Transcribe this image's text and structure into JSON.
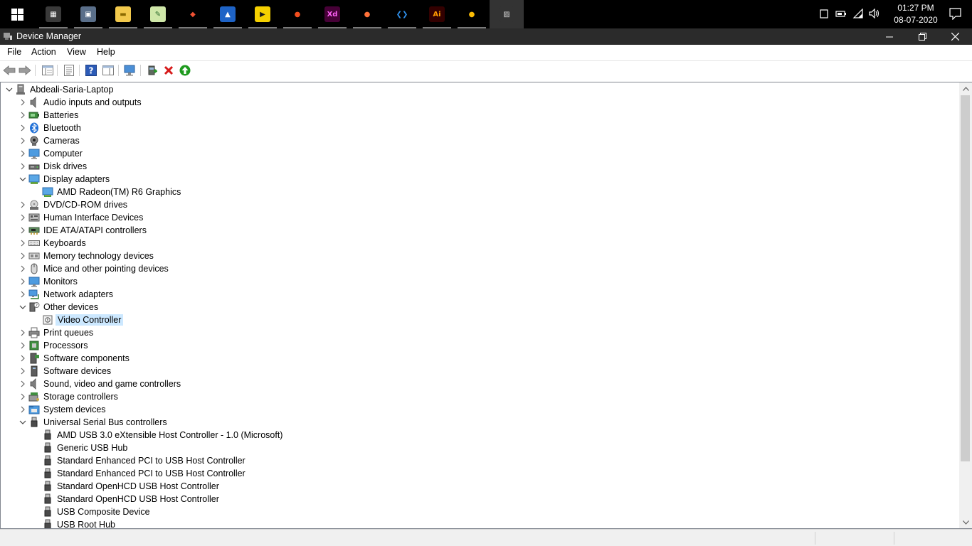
{
  "taskbar": {
    "apps": [
      {
        "name": "calculator",
        "glyph": "▦",
        "bg": "#3a3a3a",
        "fg": "#ffffff"
      },
      {
        "name": "photos",
        "glyph": "▣",
        "bg": "#5a6f8a",
        "fg": "#ffffff"
      },
      {
        "name": "file-explorer",
        "glyph": "▬",
        "bg": "#f2c94c",
        "fg": "#8a6a00"
      },
      {
        "name": "notepad",
        "glyph": "✎",
        "bg": "#cfe7a8",
        "fg": "#2e6b2e"
      },
      {
        "name": "git",
        "glyph": "◆",
        "bg": "#000000",
        "fg": "#f05133"
      },
      {
        "name": "photo-viewer",
        "glyph": "▲",
        "bg": "#1e63c6",
        "fg": "#ffffff"
      },
      {
        "name": "vlc-player",
        "glyph": "▶",
        "bg": "#f5d000",
        "fg": "#1a1a1a"
      },
      {
        "name": "figma",
        "glyph": "●",
        "bg": "#000000",
        "fg": "#f24e1e"
      },
      {
        "name": "adobe-xd",
        "glyph": "Xd",
        "bg": "#470137",
        "fg": "#ff61f6"
      },
      {
        "name": "firefox",
        "glyph": "●",
        "bg": "#000000",
        "fg": "#ff7139"
      },
      {
        "name": "vs-code",
        "glyph": "❮❯",
        "bg": "#000000",
        "fg": "#2f8fea"
      },
      {
        "name": "adobe-illustrator",
        "glyph": "Ai",
        "bg": "#330000",
        "fg": "#ff9a00"
      },
      {
        "name": "chrome",
        "glyph": "●",
        "bg": "#000000",
        "fg": "#fbbc05"
      },
      {
        "name": "device-manager",
        "glyph": "▨",
        "bg": "#333333",
        "fg": "#d0d0d0"
      }
    ],
    "time": "01:27 PM",
    "date": "08-07-2020"
  },
  "window": {
    "title": "Device Manager"
  },
  "menu": [
    "File",
    "Action",
    "View",
    "Help"
  ],
  "tree": {
    "root": "Abdeali-Saria-Laptop",
    "nodes": [
      {
        "label": "Audio inputs and outputs",
        "level": 1,
        "expanded": false,
        "icon": "speaker-icon"
      },
      {
        "label": "Batteries",
        "level": 1,
        "expanded": false,
        "icon": "battery-icon"
      },
      {
        "label": "Bluetooth",
        "level": 1,
        "expanded": false,
        "icon": "bluetooth-icon"
      },
      {
        "label": "Cameras",
        "level": 1,
        "expanded": false,
        "icon": "camera-icon"
      },
      {
        "label": "Computer",
        "level": 1,
        "expanded": false,
        "icon": "monitor-icon"
      },
      {
        "label": "Disk drives",
        "level": 1,
        "expanded": false,
        "icon": "disk-drive-icon"
      },
      {
        "label": "Display adapters",
        "level": 1,
        "expanded": true,
        "icon": "display-adapter-icon"
      },
      {
        "label": "AMD Radeon(TM) R6 Graphics",
        "level": 2,
        "icon": "display-adapter-icon"
      },
      {
        "label": "DVD/CD-ROM drives",
        "level": 1,
        "expanded": false,
        "icon": "dvd-drive-icon"
      },
      {
        "label": "Human Interface Devices",
        "level": 1,
        "expanded": false,
        "icon": "hid-icon"
      },
      {
        "label": "IDE ATA/ATAPI controllers",
        "level": 1,
        "expanded": false,
        "icon": "ide-controller-icon"
      },
      {
        "label": "Keyboards",
        "level": 1,
        "expanded": false,
        "icon": "keyboard-icon"
      },
      {
        "label": "Memory technology devices",
        "level": 1,
        "expanded": false,
        "icon": "memory-icon"
      },
      {
        "label": "Mice and other pointing devices",
        "level": 1,
        "expanded": false,
        "icon": "mouse-icon"
      },
      {
        "label": "Monitors",
        "level": 1,
        "expanded": false,
        "icon": "monitor-icon"
      },
      {
        "label": "Network adapters",
        "level": 1,
        "expanded": false,
        "icon": "network-icon"
      },
      {
        "label": "Other devices",
        "level": 1,
        "expanded": true,
        "icon": "unknown-device-icon"
      },
      {
        "label": "Video Controller",
        "level": 2,
        "selected": true,
        "icon": "warning-device-icon"
      },
      {
        "label": "Print queues",
        "level": 1,
        "expanded": false,
        "icon": "printer-icon"
      },
      {
        "label": "Processors",
        "level": 1,
        "expanded": false,
        "icon": "processor-icon"
      },
      {
        "label": "Software components",
        "level": 1,
        "expanded": false,
        "icon": "software-component-icon"
      },
      {
        "label": "Software devices",
        "level": 1,
        "expanded": false,
        "icon": "software-device-icon"
      },
      {
        "label": "Sound, video and game controllers",
        "level": 1,
        "expanded": false,
        "icon": "speaker-icon"
      },
      {
        "label": "Storage controllers",
        "level": 1,
        "expanded": false,
        "icon": "storage-icon"
      },
      {
        "label": "System devices",
        "level": 1,
        "expanded": false,
        "icon": "system-folder-icon"
      },
      {
        "label": "Universal Serial Bus controllers",
        "level": 1,
        "expanded": true,
        "icon": "usb-icon"
      },
      {
        "label": "AMD USB 3.0 eXtensible Host Controller - 1.0 (Microsoft)",
        "level": 2,
        "icon": "usb-icon"
      },
      {
        "label": "Generic USB Hub",
        "level": 2,
        "icon": "usb-icon"
      },
      {
        "label": "Standard Enhanced PCI to USB Host Controller",
        "level": 2,
        "icon": "usb-icon"
      },
      {
        "label": "Standard Enhanced PCI to USB Host Controller",
        "level": 2,
        "icon": "usb-icon"
      },
      {
        "label": "Standard OpenHCD USB Host Controller",
        "level": 2,
        "icon": "usb-icon"
      },
      {
        "label": "Standard OpenHCD USB Host Controller",
        "level": 2,
        "icon": "usb-icon"
      },
      {
        "label": "USB Composite Device",
        "level": 2,
        "icon": "usb-icon"
      },
      {
        "label": "USB Root Hub",
        "level": 2,
        "icon": "usb-icon"
      }
    ]
  },
  "colors": {
    "selection": "#cce8ff",
    "titlebar": "#2b2b2b",
    "taskbar": "#000000"
  }
}
